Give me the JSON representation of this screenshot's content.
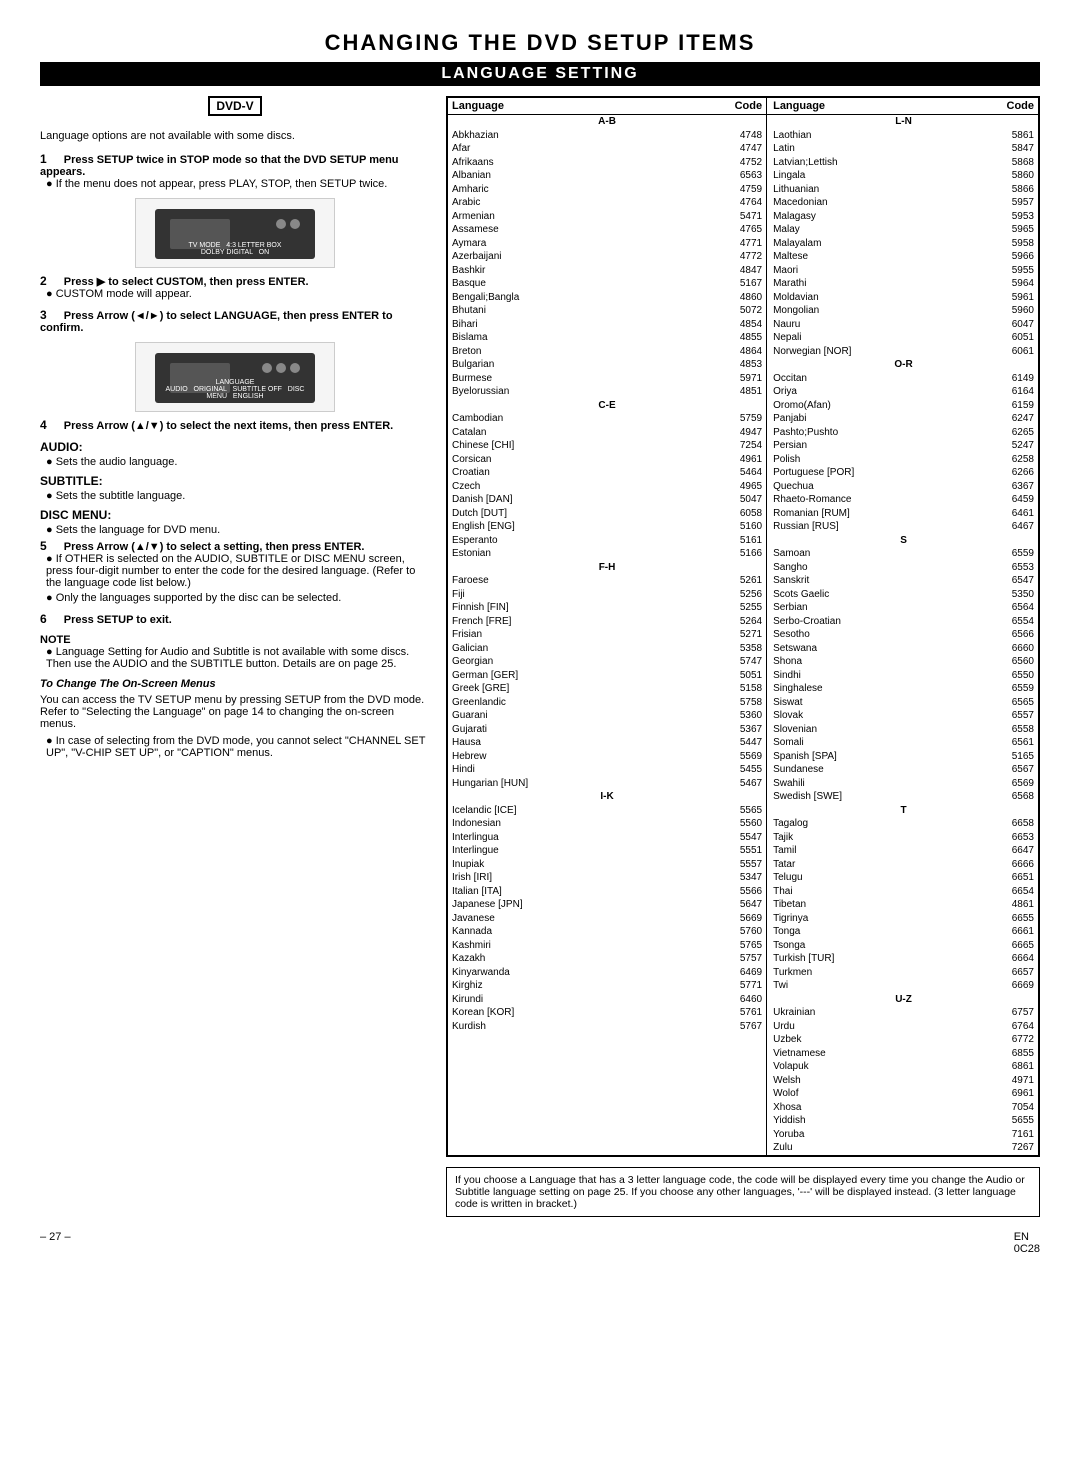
{
  "page": {
    "main_title": "CHANGING THE DVD SETUP ITEMS",
    "section_title": "LANGUAGE SETTING",
    "dvd_badge": "DVD-V",
    "language_note": "Language options are not available with some discs.",
    "steps": [
      {
        "num": "1",
        "bold": "Press SETUP twice in STOP mode so that the DVD SETUP menu appears.",
        "bullets": [
          "If the menu does not appear, press PLAY, STOP, then SETUP twice."
        ]
      },
      {
        "num": "2",
        "bold": "Press ▶ to select CUSTOM, then press ENTER.",
        "bullets": [
          "CUSTOM mode will appear."
        ]
      },
      {
        "num": "3",
        "bold": "Press Arrow (◄/►) to select LANGUAGE, then press ENTER to confirm.",
        "bullets": []
      },
      {
        "num": "4",
        "bold": "Press Arrow (▲/▼) to select the next items, then press ENTER.",
        "bullets": []
      }
    ],
    "audio_section": {
      "title": "AUDIO:",
      "bullet": "Sets the audio language."
    },
    "subtitle_section": {
      "title": "SUBTITLE:",
      "bullet": "Sets the subtitle language."
    },
    "disc_menu_section": {
      "title": "DISC MENU:",
      "bullet": "Sets the language for DVD menu."
    },
    "step5": {
      "num": "5",
      "bold": "Press Arrow (▲/▼) to select a setting, then press ENTER.",
      "bullets": [
        "If OTHER is selected on the AUDIO, SUBTITLE or DISC MENU screen, press four-digit number to enter the code for the desired language. (Refer to the language code list below.)",
        "Only the languages supported by the disc can be selected."
      ]
    },
    "step6": {
      "num": "6",
      "bold": "Press SETUP to exit."
    },
    "note": {
      "label": "NOTE",
      "bullets": [
        "Language Setting for Audio and Subtitle is not available with some discs. Then use the AUDIO and the SUBTITLE button. Details are on page 25."
      ]
    },
    "sub_section": {
      "title": "To Change The On-Screen Menus",
      "paragraphs": [
        "You can access the TV SETUP menu by pressing SETUP from the DVD mode. Refer to \"Selecting the Language\" on page 14 to changing the on-screen menus.",
        "● In case of selecting from the DVD mode, you cannot select \"CHANNEL SET UP\", \"V-CHIP SET UP\", or \"CAPTION\" menus."
      ]
    },
    "bottom_note": "If you choose a Language that has a 3 letter language code, the code will be displayed every time you change the Audio or Subtitle language setting on page 25. If you choose any other languages, '---' will be displayed instead. (3 letter language code is written in bracket.)",
    "footer": {
      "left": "– 27 –",
      "right": "EN\n0C28"
    }
  },
  "language_table": {
    "col1_header": "Language",
    "col2_header": "Code",
    "col3_header": "Language",
    "col4_header": "Code",
    "sections": [
      {
        "label": "A-B",
        "entries": [
          [
            "Abkhazian",
            "4748"
          ],
          [
            "Afar",
            "4747"
          ],
          [
            "Afrikaans",
            "4752"
          ],
          [
            "Albanian",
            "6563"
          ],
          [
            "Amharic",
            "4759"
          ],
          [
            "Arabic",
            "4764"
          ],
          [
            "Armenian",
            "5471"
          ],
          [
            "Assamese",
            "4765"
          ],
          [
            "Aymara",
            "4771"
          ],
          [
            "Azerbaijani",
            "4772"
          ],
          [
            "Bashkir",
            "4847"
          ],
          [
            "Basque",
            "5167"
          ],
          [
            "Bengali;Bangla",
            "4860"
          ],
          [
            "Bhutani",
            "5072"
          ],
          [
            "Bihari",
            "4854"
          ],
          [
            "Bislama",
            "4855"
          ],
          [
            "Breton",
            "4864"
          ],
          [
            "Bulgarian",
            "4853"
          ],
          [
            "Burmese",
            "5971"
          ],
          [
            "Byelorussian",
            "4851"
          ]
        ]
      },
      {
        "label": "C-E",
        "entries": [
          [
            "Cambodian",
            "5759"
          ],
          [
            "Catalan",
            "4947"
          ],
          [
            "Chinese [CHI]",
            "7254"
          ],
          [
            "Corsican",
            "4961"
          ],
          [
            "Croatian",
            "5464"
          ],
          [
            "Czech",
            "4965"
          ],
          [
            "Danish [DAN]",
            "5047"
          ],
          [
            "Dutch [DUT]",
            "6058"
          ],
          [
            "English [ENG]",
            "5160"
          ],
          [
            "Esperanto",
            "5161"
          ],
          [
            "Estonian",
            "5166"
          ]
        ]
      },
      {
        "label": "F-H",
        "entries": [
          [
            "Faroese",
            "5261"
          ],
          [
            "Fiji",
            "5256"
          ],
          [
            "Finnish [FIN]",
            "5255"
          ],
          [
            "French [FRE]",
            "5264"
          ],
          [
            "Frisian",
            "5271"
          ],
          [
            "Galician",
            "5358"
          ],
          [
            "Georgian",
            "5747"
          ],
          [
            "German [GER]",
            "5051"
          ],
          [
            "Greek [GRE]",
            "5158"
          ],
          [
            "Greenlandic",
            "5758"
          ],
          [
            "Guarani",
            "5360"
          ],
          [
            "Gujarati",
            "5367"
          ],
          [
            "Hausa",
            "5447"
          ],
          [
            "Hebrew",
            "5569"
          ],
          [
            "Hindi",
            "5455"
          ],
          [
            "Hungarian [HUN]",
            "5467"
          ]
        ]
      },
      {
        "label": "I-K",
        "entries": [
          [
            "Icelandic [ICE]",
            "5565"
          ],
          [
            "Indonesian",
            "5560"
          ],
          [
            "Interlingua",
            "5547"
          ],
          [
            "Interlingue",
            "5551"
          ],
          [
            "Inupiak",
            "5557"
          ],
          [
            "Irish [IRI]",
            "5347"
          ],
          [
            "Italian [ITA]",
            "5566"
          ],
          [
            "Japanese [JPN]",
            "5647"
          ],
          [
            "Javanese",
            "5669"
          ],
          [
            "Kannada",
            "5760"
          ],
          [
            "Kashmiri",
            "5765"
          ],
          [
            "Kazakh",
            "5757"
          ],
          [
            "Kinyarwanda",
            "6469"
          ],
          [
            "Kirghiz",
            "5771"
          ],
          [
            "Kirundi",
            "6460"
          ],
          [
            "Korean [KOR]",
            "5761"
          ],
          [
            "Kurdish",
            "5767"
          ]
        ]
      }
    ],
    "right_sections": [
      {
        "label": "L-N",
        "entries": [
          [
            "Laothian",
            "5861"
          ],
          [
            "Latin",
            "5847"
          ],
          [
            "Latvian;Lettish",
            "5868"
          ],
          [
            "Lingala",
            "5860"
          ],
          [
            "Lithuanian",
            "5866"
          ],
          [
            "Macedonian",
            "5957"
          ],
          [
            "Malagasy",
            "5953"
          ],
          [
            "Malay",
            "5965"
          ],
          [
            "Malayalam",
            "5958"
          ],
          [
            "Maltese",
            "5966"
          ],
          [
            "Maori",
            "5955"
          ],
          [
            "Marathi",
            "5964"
          ],
          [
            "Moldavian",
            "5961"
          ],
          [
            "Mongolian",
            "5960"
          ],
          [
            "Nauru",
            "6047"
          ],
          [
            "Nepali",
            "6051"
          ],
          [
            "Norwegian [NOR]",
            "6061"
          ]
        ]
      },
      {
        "label": "O-R",
        "entries": [
          [
            "Occitan",
            "6149"
          ],
          [
            "Oriya",
            "6164"
          ],
          [
            "Oromo(Afan)",
            "6159"
          ],
          [
            "Panjabi",
            "6247"
          ],
          [
            "Pashto;Pushto",
            "6265"
          ],
          [
            "Persian",
            "5247"
          ],
          [
            "Polish",
            "6258"
          ],
          [
            "Portuguese [POR]",
            "6266"
          ],
          [
            "Quechua",
            "6367"
          ],
          [
            "Rhaeto-Romance",
            "6459"
          ],
          [
            "Romanian [RUM]",
            "6461"
          ],
          [
            "Russian [RUS]",
            "6467"
          ]
        ]
      },
      {
        "label": "S",
        "entries": [
          [
            "Samoan",
            "6559"
          ],
          [
            "Sangho",
            "6553"
          ],
          [
            "Sanskrit",
            "6547"
          ],
          [
            "Scots Gaelic",
            "5350"
          ],
          [
            "Serbian",
            "6564"
          ],
          [
            "Serbo-Croatian",
            "6554"
          ],
          [
            "Sesotho",
            "6566"
          ],
          [
            "Setswana",
            "6660"
          ],
          [
            "Shona",
            "6560"
          ],
          [
            "Sindhi",
            "6550"
          ],
          [
            "Singhalese",
            "6559"
          ],
          [
            "Siswat",
            "6565"
          ],
          [
            "Slovak",
            "6557"
          ],
          [
            "Slovenian",
            "6558"
          ],
          [
            "Somali",
            "6561"
          ],
          [
            "Spanish [SPA]",
            "5165"
          ],
          [
            "Sundanese",
            "6567"
          ],
          [
            "Swahili",
            "6569"
          ],
          [
            "Swedish [SWE]",
            "6568"
          ]
        ]
      },
      {
        "label": "T",
        "entries": [
          [
            "Tagalog",
            "6658"
          ],
          [
            "Tajik",
            "6653"
          ],
          [
            "Tamil",
            "6647"
          ],
          [
            "Tatar",
            "6666"
          ],
          [
            "Telugu",
            "6651"
          ],
          [
            "Thai",
            "6654"
          ],
          [
            "Tibetan",
            "4861"
          ],
          [
            "Tigrinya",
            "6655"
          ],
          [
            "Tonga",
            "6661"
          ],
          [
            "Tsonga",
            "6665"
          ],
          [
            "Turkish [TUR]",
            "6664"
          ],
          [
            "Turkmen",
            "6657"
          ],
          [
            "Twi",
            "6669"
          ]
        ]
      },
      {
        "label": "U-Z",
        "entries": [
          [
            "Ukrainian",
            "6757"
          ],
          [
            "Urdu",
            "6764"
          ],
          [
            "Uzbek",
            "6772"
          ],
          [
            "Vietnamese",
            "6855"
          ],
          [
            "Volapuk",
            "6861"
          ],
          [
            "Welsh",
            "4971"
          ],
          [
            "Wolof",
            "6961"
          ],
          [
            "Xhosa",
            "7054"
          ],
          [
            "Yiddish",
            "5655"
          ],
          [
            "Yoruba",
            "7161"
          ],
          [
            "Zulu",
            "7267"
          ]
        ]
      }
    ]
  }
}
